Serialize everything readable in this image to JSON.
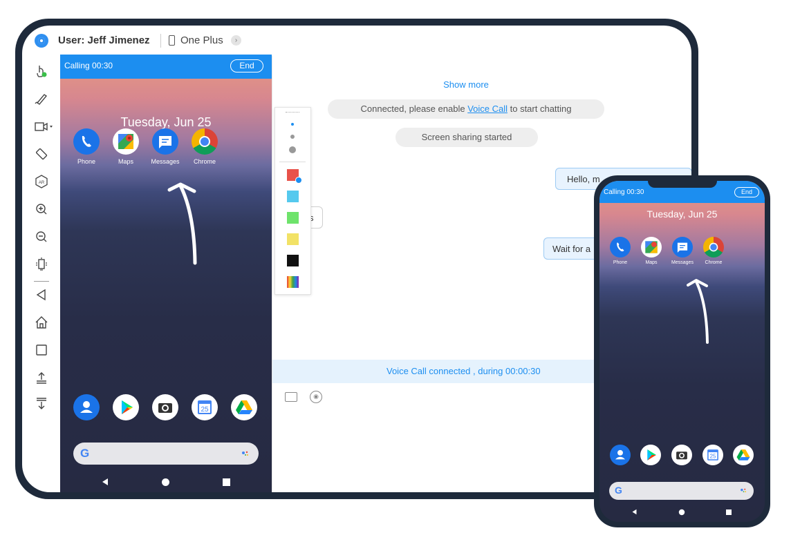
{
  "header": {
    "user_label": "User: Jeff Jimenez",
    "device_name": "One Plus",
    "device_arrow": "›"
  },
  "sidebar": {
    "items": [
      {
        "name": "remote-control-icon",
        "glyph": "☝"
      },
      {
        "name": "draw-pen-icon",
        "glyph": "✎"
      },
      {
        "name": "video-record-icon",
        "glyph": "▭"
      },
      {
        "name": "rotate-icon",
        "glyph": "⟲"
      },
      {
        "name": "ar-icon",
        "glyph": "AR"
      },
      {
        "name": "zoom-in-icon",
        "glyph": "⊕"
      },
      {
        "name": "zoom-out-icon",
        "glyph": "⊖"
      },
      {
        "name": "vibrate-icon",
        "glyph": "⌷"
      },
      {
        "name": "back-icon",
        "glyph": "◁"
      },
      {
        "name": "home-icon",
        "glyph": "⌂"
      },
      {
        "name": "recents-icon",
        "glyph": "☐"
      },
      {
        "name": "upload-icon",
        "glyph": "⤒"
      },
      {
        "name": "download-icon",
        "glyph": "⤓"
      }
    ]
  },
  "remote_phone": {
    "calling": "Calling 00:30",
    "end": "End",
    "date": "Tuesday, Jun 25",
    "apps": [
      "Phone",
      "Maps",
      "Messages",
      "Chrome"
    ],
    "calendar_day": "25",
    "search_g": "G"
  },
  "color_picker": {
    "colors": [
      "#e8524a",
      "#55c9ee",
      "#6ee36b",
      "#f2e266",
      "#111111"
    ]
  },
  "chat": {
    "show_more": "Show more",
    "connected_prefix": "Connected,  please enable ",
    "connected_link": "Voice Call",
    "connected_suffix": " to start chatting",
    "screen_sharing": "Screen sharing started",
    "msg_out_1": "Hello,  m",
    "msg_in_1": "s",
    "msg_out_2": "Wait for a",
    "voice_call_status": "Voice Call connected , during 00:00:30"
  },
  "floating_phone": {
    "calling": "Calling 00:30",
    "end": "End",
    "date": "Tuesday, Jun 25",
    "apps": [
      "Phone",
      "Maps",
      "Messages",
      "Chrome"
    ],
    "calendar_day": "25",
    "search_g": "G"
  }
}
